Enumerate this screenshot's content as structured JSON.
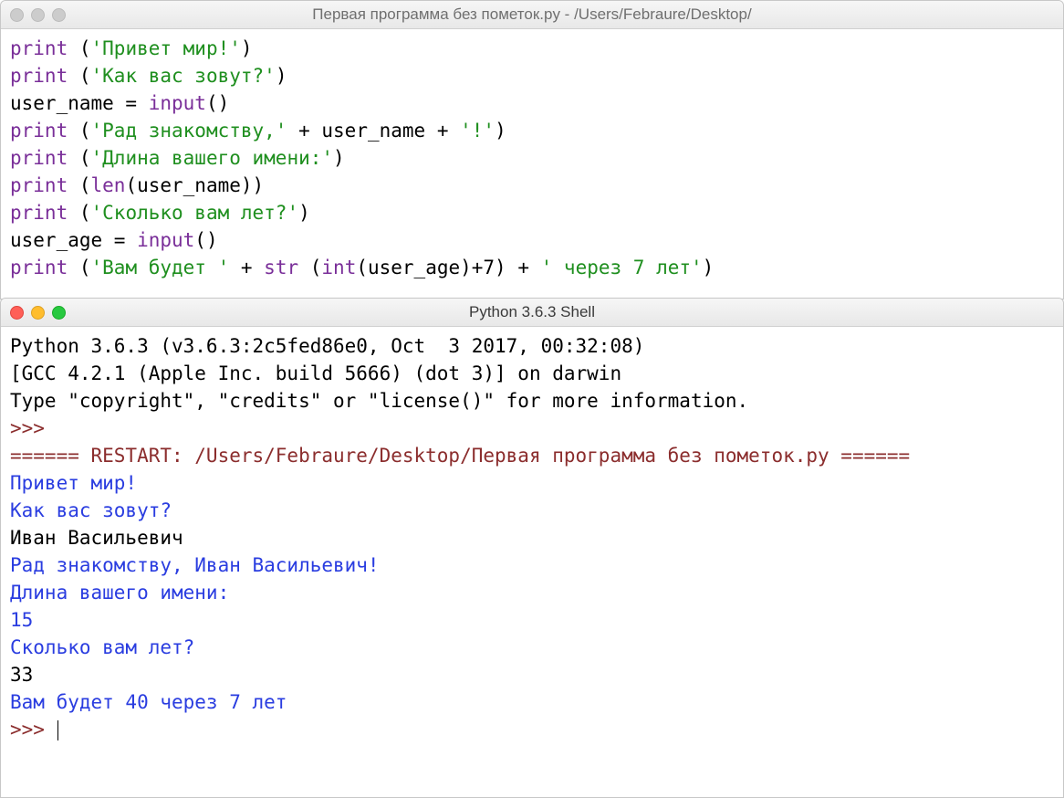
{
  "editor": {
    "title": "Первая программа без пометок.py - /Users/Febraure/Desktop/",
    "code": {
      "l1": {
        "call": "print",
        "paren_open": " (",
        "str": "'Привет мир!'",
        "paren_close": ")"
      },
      "l2": {
        "call": "print",
        "paren_open": " (",
        "str": "'Как вас зовут?'",
        "paren_close": ")"
      },
      "l3": {
        "lhs": "user_name = ",
        "call": "input",
        "paren": "()"
      },
      "l4": {
        "call": "print",
        "paren_open": " (",
        "str1": "'Рад знакомству,'",
        "plus1": " + ",
        "id1": "user_name",
        "plus2": " + ",
        "str2": "'!'",
        "paren_close": ")"
      },
      "l5": {
        "call": "print",
        "paren_open": " (",
        "str": "'Длина вашего имени:'",
        "paren_close": ")"
      },
      "l6": {
        "call": "print",
        "paren_open": " (",
        "fn": "len",
        "inner": "(user_name))"
      },
      "l7": {
        "call": "print",
        "paren_open": " (",
        "str": "'Сколько вам лет?'",
        "paren_close": ")"
      },
      "l8": {
        "lhs": "user_age = ",
        "call": "input",
        "paren": "()"
      },
      "l9": {
        "call": "print",
        "paren_open": " (",
        "str1": "'Вам будет '",
        "plus1": " + ",
        "fn1": "str",
        "space1": " (",
        "fn2": "int",
        "inner": "(user_age)+7) + ",
        "str2": "' через 7 лет'",
        "paren_close": ")"
      }
    }
  },
  "shell": {
    "title": "Python 3.6.3 Shell",
    "header": {
      "l1": "Python 3.6.3 (v3.6.3:2c5fed86e0, Oct  3 2017, 00:32:08) ",
      "l2": "[GCC 4.2.1 (Apple Inc. build 5666) (dot 3)] on darwin",
      "l3": "Type \"copyright\", \"credits\" or \"license()\" for more information."
    },
    "prompt1": ">>> ",
    "restart": "====== RESTART: /Users/Febraure/Desktop/Первая программа без пометок.py ======",
    "out": {
      "o1": "Привет мир!",
      "o2": "Как вас зовут?",
      "in1": "Иван Васильевич",
      "o3": "Рад знакомству, Иван Васильевич!",
      "o4": "Длина вашего имени:",
      "o5": "15",
      "o6": "Сколько вам лет?",
      "in2": "33",
      "o7": "Вам будет 40 через 7 лет"
    },
    "prompt2": ">>> "
  }
}
